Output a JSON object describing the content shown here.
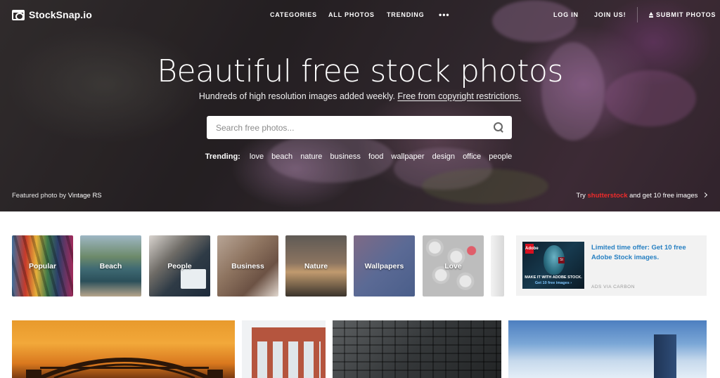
{
  "brand": {
    "name": "StockSnap.io"
  },
  "nav": {
    "categories": "CATEGORIES",
    "all_photos": "ALL PHOTOS",
    "trending": "TRENDING",
    "more": "•••",
    "login": "LOG IN",
    "join": "JOIN US!",
    "submit": "SUBMIT PHOTOS"
  },
  "hero": {
    "title": "Beautiful free stock photos",
    "subtitle": "Hundreds of high resolution images added weekly.",
    "subtitle_link": "Free from copyright restrictions."
  },
  "search": {
    "placeholder": "Search free photos..."
  },
  "trending": {
    "label": "Trending:",
    "tags": [
      "love",
      "beach",
      "nature",
      "business",
      "food",
      "wallpaper",
      "design",
      "office",
      "people"
    ]
  },
  "featured": {
    "prefix": "Featured photo by",
    "author": "Vintage RS"
  },
  "promo": {
    "prefix": "Try",
    "brand": "shutterstock",
    "suffix": "and get 10 free images"
  },
  "categories": [
    "Popular",
    "Beach",
    "People",
    "Business",
    "Nature",
    "Wallpapers",
    "Love"
  ],
  "ad": {
    "text": "Limited time offer: Get 10 free Adobe Stock images.",
    "via": "ADS VIA CARBON",
    "image_line1": "MAKE IT WITH ADOBE STOCK.",
    "image_line2": "Get 10 free images ›",
    "logo": "Adobe",
    "badge": "St"
  },
  "colors": {
    "accent_link": "#2780c2",
    "shutterstock_red": "#ee2b2b"
  }
}
